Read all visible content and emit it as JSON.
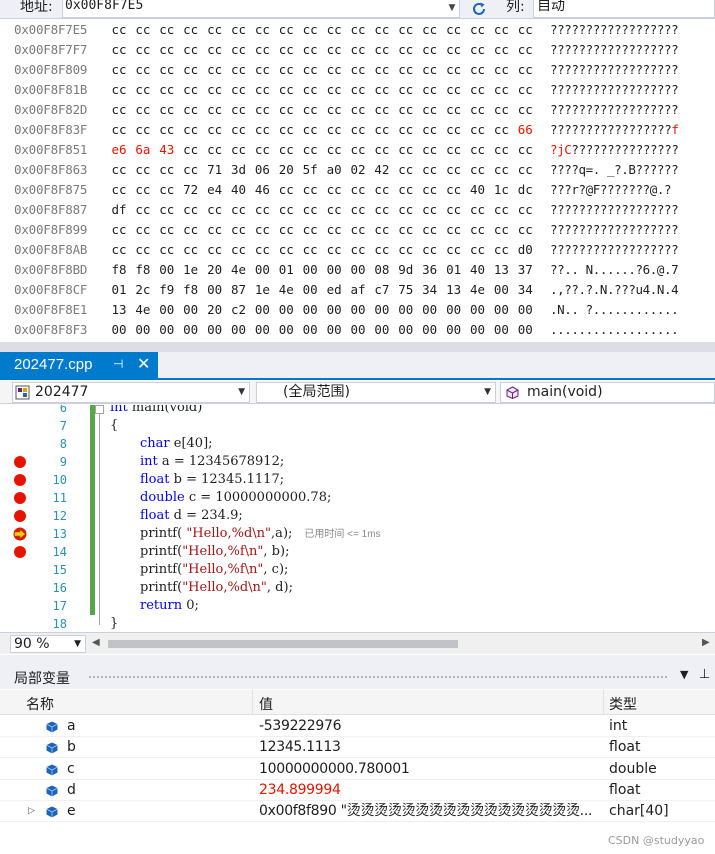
{
  "memory": {
    "address_label": "地址:",
    "address_value": "0x00F8F7E5",
    "columns_label": "列:",
    "columns_value": "自动",
    "rows": [
      {
        "addr": "0x00F8F7E5",
        "bytes": [
          "cc",
          "cc",
          "cc",
          "cc",
          "cc",
          "cc",
          "cc",
          "cc",
          "cc",
          "cc",
          "cc",
          "cc",
          "cc",
          "cc",
          "cc",
          "cc",
          "cc",
          "cc"
        ],
        "ascii": "??????????????????"
      },
      {
        "addr": "0x00F8F7F7",
        "bytes": [
          "cc",
          "cc",
          "cc",
          "cc",
          "cc",
          "cc",
          "cc",
          "cc",
          "cc",
          "cc",
          "cc",
          "cc",
          "cc",
          "cc",
          "cc",
          "cc",
          "cc",
          "cc"
        ],
        "ascii": "??????????????????"
      },
      {
        "addr": "0x00F8F809",
        "bytes": [
          "cc",
          "cc",
          "cc",
          "cc",
          "cc",
          "cc",
          "cc",
          "cc",
          "cc",
          "cc",
          "cc",
          "cc",
          "cc",
          "cc",
          "cc",
          "cc",
          "cc",
          "cc"
        ],
        "ascii": "??????????????????"
      },
      {
        "addr": "0x00F8F81B",
        "bytes": [
          "cc",
          "cc",
          "cc",
          "cc",
          "cc",
          "cc",
          "cc",
          "cc",
          "cc",
          "cc",
          "cc",
          "cc",
          "cc",
          "cc",
          "cc",
          "cc",
          "cc",
          "cc"
        ],
        "ascii": "??????????????????"
      },
      {
        "addr": "0x00F8F82D",
        "bytes": [
          "cc",
          "cc",
          "cc",
          "cc",
          "cc",
          "cc",
          "cc",
          "cc",
          "cc",
          "cc",
          "cc",
          "cc",
          "cc",
          "cc",
          "cc",
          "cc",
          "cc",
          "cc"
        ],
        "ascii": "??????????????????"
      },
      {
        "addr": "0x00F8F83F",
        "bytes": [
          "cc",
          "cc",
          "cc",
          "cc",
          "cc",
          "cc",
          "cc",
          "cc",
          "cc",
          "cc",
          "cc",
          "cc",
          "cc",
          "cc",
          "cc",
          "cc",
          "cc",
          "66"
        ],
        "changed": [
          17
        ],
        "ascii": "?????????????????f",
        "ascii_changed": [
          17
        ]
      },
      {
        "addr": "0x00F8F851",
        "bytes": [
          "e6",
          "6a",
          "43",
          "cc",
          "cc",
          "cc",
          "cc",
          "cc",
          "cc",
          "cc",
          "cc",
          "cc",
          "cc",
          "cc",
          "cc",
          "cc",
          "cc",
          "cc"
        ],
        "changed": [
          0,
          1,
          2
        ],
        "ascii": "?jC???????????????",
        "ascii_changed": [
          0,
          1,
          2
        ]
      },
      {
        "addr": "0x00F8F863",
        "bytes": [
          "cc",
          "cc",
          "cc",
          "cc",
          "71",
          "3d",
          "06",
          "20",
          "5f",
          "a0",
          "02",
          "42",
          "cc",
          "cc",
          "cc",
          "cc",
          "cc",
          "cc"
        ],
        "ascii": "????q=. _?.B??????"
      },
      {
        "addr": "0x00F8F875",
        "bytes": [
          "cc",
          "cc",
          "cc",
          "72",
          "e4",
          "40",
          "46",
          "cc",
          "cc",
          "cc",
          "cc",
          "cc",
          "cc",
          "cc",
          "cc",
          "40",
          "1c",
          "dc"
        ],
        "ascii": "???r?@F???????@.?"
      },
      {
        "addr": "0x00F8F887",
        "bytes": [
          "df",
          "cc",
          "cc",
          "cc",
          "cc",
          "cc",
          "cc",
          "cc",
          "cc",
          "cc",
          "cc",
          "cc",
          "cc",
          "cc",
          "cc",
          "cc",
          "cc",
          "cc"
        ],
        "ascii": "??????????????????"
      },
      {
        "addr": "0x00F8F899",
        "bytes": [
          "cc",
          "cc",
          "cc",
          "cc",
          "cc",
          "cc",
          "cc",
          "cc",
          "cc",
          "cc",
          "cc",
          "cc",
          "cc",
          "cc",
          "cc",
          "cc",
          "cc",
          "cc"
        ],
        "ascii": "??????????????????"
      },
      {
        "addr": "0x00F8F8AB",
        "bytes": [
          "cc",
          "cc",
          "cc",
          "cc",
          "cc",
          "cc",
          "cc",
          "cc",
          "cc",
          "cc",
          "cc",
          "cc",
          "cc",
          "cc",
          "cc",
          "cc",
          "cc",
          "d0"
        ],
        "ascii": "??????????????????"
      },
      {
        "addr": "0x00F8F8BD",
        "bytes": [
          "f8",
          "f8",
          "00",
          "1e",
          "20",
          "4e",
          "00",
          "01",
          "00",
          "00",
          "00",
          "08",
          "9d",
          "36",
          "01",
          "40",
          "13",
          "37"
        ],
        "ascii": "??.. N......?6.@.7"
      },
      {
        "addr": "0x00F8F8CF",
        "bytes": [
          "01",
          "2c",
          "f9",
          "f8",
          "00",
          "87",
          "1e",
          "4e",
          "00",
          "ed",
          "af",
          "c7",
          "75",
          "34",
          "13",
          "4e",
          "00",
          "34"
        ],
        "ascii": ".,??.?.N.???u4.N.4"
      },
      {
        "addr": "0x00F8F8E1",
        "bytes": [
          "13",
          "4e",
          "00",
          "00",
          "20",
          "c2",
          "00",
          "00",
          "00",
          "00",
          "00",
          "00",
          "00",
          "00",
          "00",
          "00",
          "00",
          "00"
        ],
        "ascii": ".N.. ?............"
      },
      {
        "addr": "0x00F8F8F3",
        "bytes": [
          "00",
          "00",
          "00",
          "00",
          "00",
          "00",
          "00",
          "00",
          "00",
          "00",
          "00",
          "00",
          "00",
          "00",
          "00",
          "00",
          "00",
          "00"
        ],
        "ascii": ".................."
      }
    ]
  },
  "editor": {
    "tab_label": "202477.cpp",
    "pin_glyph": "⊣",
    "close_glyph": "✕",
    "nav": {
      "project": "202477",
      "scope": "(全局范围)",
      "function": "main(void)"
    },
    "zoom": "90 %",
    "timing_text": "已用时间 <= 1ms",
    "lines": [
      {
        "num": "6",
        "text": "int main(void)",
        "bp": "",
        "partial": true
      },
      {
        "num": "7",
        "text": "{",
        "bp": ""
      },
      {
        "num": "8",
        "text": "char e[40];",
        "bp": ""
      },
      {
        "num": "9",
        "text": "int a = 12345678912;",
        "bp": "breakpoint"
      },
      {
        "num": "10",
        "text": "float b = 12345.1117;",
        "bp": "breakpoint"
      },
      {
        "num": "11",
        "text": "double c = 10000000000.78;",
        "bp": "breakpoint"
      },
      {
        "num": "12",
        "text": "float d = 234.9;",
        "bp": "breakpoint"
      },
      {
        "num": "13",
        "text": "printf( \"Hello,%d\\n\",a);",
        "bp": "current"
      },
      {
        "num": "14",
        "text": "printf(\"Hello,%f\\n\", b);",
        "bp": "breakpoint"
      },
      {
        "num": "15",
        "text": "printf(\"Hello,%f\\n\", c);",
        "bp": ""
      },
      {
        "num": "16",
        "text": "printf(\"Hello,%d\\n\", d);",
        "bp": ""
      },
      {
        "num": "17",
        "text": "return 0;",
        "bp": ""
      },
      {
        "num": "18",
        "text": "}",
        "bp": ""
      }
    ]
  },
  "locals": {
    "title": "局部变量",
    "columns": {
      "name": "名称",
      "value": "值",
      "type": "类型"
    },
    "rows": [
      {
        "name": "a",
        "value": "-539222976",
        "type": "int",
        "changed": false,
        "expandable": false
      },
      {
        "name": "b",
        "value": "12345.1113",
        "type": "float",
        "changed": false,
        "expandable": false
      },
      {
        "name": "c",
        "value": "10000000000.780001",
        "type": "double",
        "changed": false,
        "expandable": false
      },
      {
        "name": "d",
        "value": "234.899994",
        "type": "float",
        "changed": true,
        "expandable": false
      },
      {
        "name": "e",
        "value": "0x00f8f890 \"烫烫烫烫烫烫烫烫烫烫烫烫烫烫烫烫烫...",
        "type": "char[40]",
        "changed": false,
        "expandable": true
      }
    ]
  },
  "watermark": "CSDN @studyyao",
  "colors": {
    "accent": "#007acc",
    "changed": "#e51400",
    "keyword": "#0000ff",
    "string": "#a31515",
    "line_number": "#2b91af"
  }
}
